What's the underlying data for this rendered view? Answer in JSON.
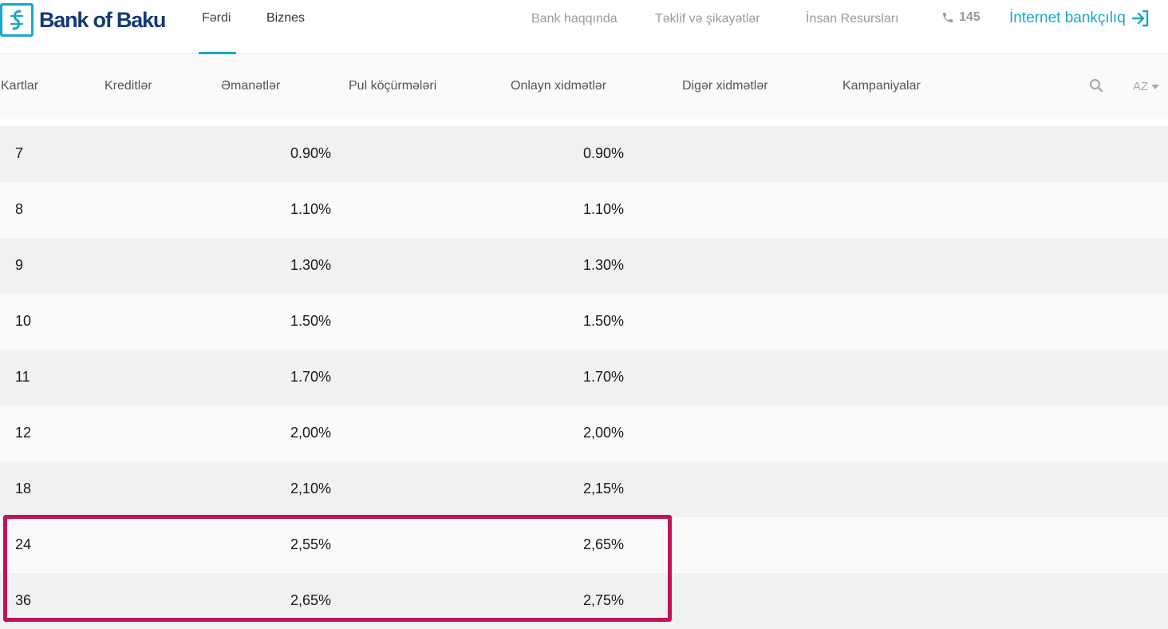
{
  "brand": {
    "name": "Bank of Baku",
    "accent": "#1aa7c9",
    "logo_text_color": "#123a78",
    "highlight_color": "#c1125a"
  },
  "top_tabs": [
    {
      "label": "Fərdi",
      "active": true
    },
    {
      "label": "Biznes",
      "active": false
    }
  ],
  "top_links": {
    "about": "Bank haqqında",
    "feedback": "Təklif və şikayətlər",
    "hr": "İnsan Resursları",
    "phone": "145",
    "internet_banking": "İnternet bankçılıq"
  },
  "nav": {
    "items": [
      "Kartlar",
      "Kreditlər",
      "Əmanətlər",
      "Pul köçürmələri",
      "Onlayn xidmətlər",
      "Digər xidmətlər",
      "Kampaniyalar"
    ],
    "language": "AZ"
  },
  "rates_table": {
    "rows": [
      {
        "term": "7",
        "rate_a": "0.90%",
        "rate_b": "0.90%"
      },
      {
        "term": "8",
        "rate_a": "1.10%",
        "rate_b": "1.10%"
      },
      {
        "term": "9",
        "rate_a": "1.30%",
        "rate_b": "1.30%"
      },
      {
        "term": "10",
        "rate_a": "1.50%",
        "rate_b": "1.50%"
      },
      {
        "term": "11",
        "rate_a": "1.70%",
        "rate_b": "1.70%"
      },
      {
        "term": "12",
        "rate_a": "2,00%",
        "rate_b": "2,00%"
      },
      {
        "term": "18",
        "rate_a": "2,10%",
        "rate_b": "2,15%"
      },
      {
        "term": "24",
        "rate_a": "2,55%",
        "rate_b": "2,65%"
      },
      {
        "term": "36",
        "rate_a": "2,65%",
        "rate_b": "2,75%"
      }
    ]
  }
}
